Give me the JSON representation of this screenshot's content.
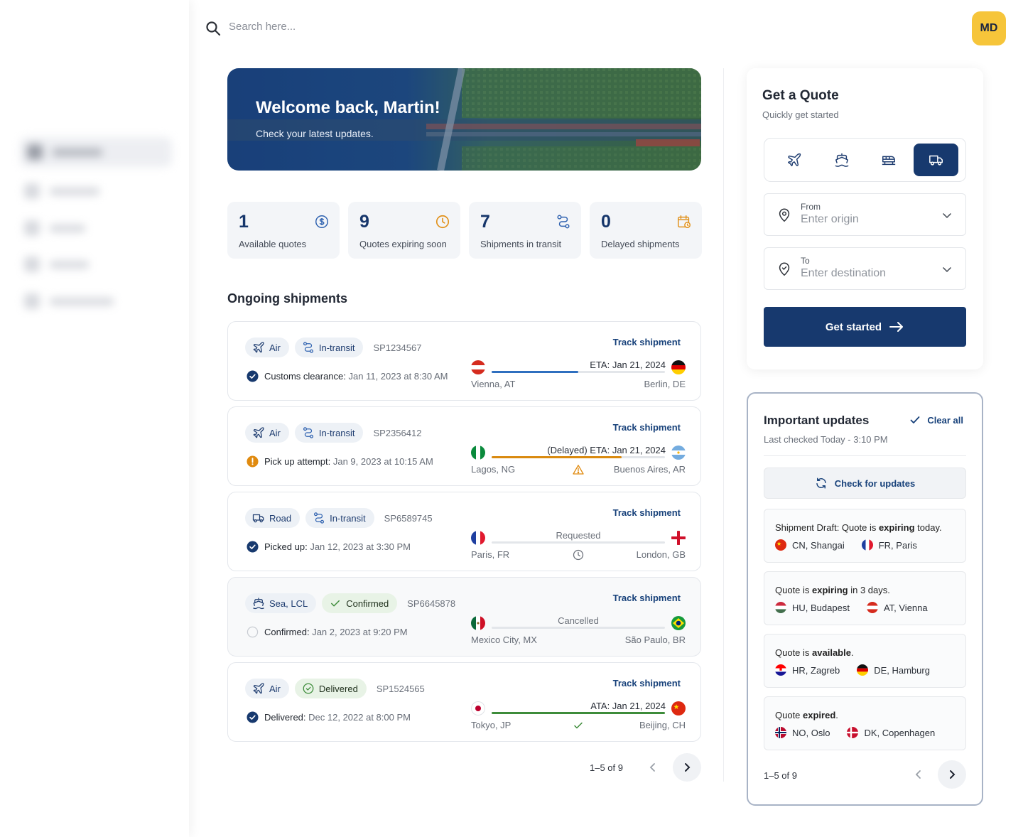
{
  "search": {
    "placeholder": "Search here..."
  },
  "user": {
    "initials": "MD"
  },
  "hero": {
    "title": "Welcome back, Martin!",
    "subtitle": "Check your latest updates."
  },
  "stats": [
    {
      "value": "1",
      "label": "Available quotes",
      "icon": "dollar-circle-icon",
      "color": "#2f62b0"
    },
    {
      "value": "9",
      "label": "Quotes expiring soon",
      "icon": "clock-icon",
      "color": "#e1911b"
    },
    {
      "value": "7",
      "label": "Shipments in transit",
      "icon": "route-icon",
      "color": "#2f62b0"
    },
    {
      "value": "0",
      "label": "Delayed shipments",
      "icon": "calendar-clock-icon",
      "color": "#e1911b"
    }
  ],
  "shipments_title": "Ongoing shipments",
  "shipments": [
    {
      "mode": "Air",
      "mode_icon": "plane-icon",
      "state": "In-transit",
      "id": "SP1234567",
      "track": "Track shipment",
      "status_label": "Customs clearance:",
      "status_date": "Jan 11, 2023 at 8:30 AM",
      "status_icon": "check-circle-icon",
      "eta": "ETA: Jan 21, 2024",
      "progress": 0.5,
      "bar_color": "#2f6fbf",
      "from_city": "Vienna, AT",
      "to_city": "Berlin, DE",
      "from_flag": "AT",
      "to_flag": "DE"
    },
    {
      "mode": "Air",
      "mode_icon": "plane-icon",
      "state": "In-transit",
      "id": "SP2356412",
      "track": "Track shipment",
      "status_label": "Pick up attempt:",
      "status_date": "Jan 9, 2023 at 10:15 AM",
      "status_icon": "warning-circle-icon",
      "eta": "(Delayed)  ETA: Jan 21, 2024",
      "progress": 0.75,
      "bar_color": "#d98a10",
      "from_city": "Lagos, NG",
      "to_city": "Buenos Aires, AR",
      "from_flag": "NG",
      "to_flag": "AR",
      "mid_icon": "warning-triangle-icon"
    },
    {
      "mode": "Road",
      "mode_icon": "truck-icon",
      "state": "In-transit",
      "id": "SP6589745",
      "track": "Track shipment",
      "status_label": "Picked up:",
      "status_date": "Jan 12, 2023 at 3:30 PM",
      "status_icon": "check-circle-icon",
      "center_label": "Requested",
      "progress": 0,
      "bar_color": "#2f6fbf",
      "from_city": "Paris, FR",
      "to_city": "London, GB",
      "from_flag": "FR",
      "to_flag": "GB",
      "mid_icon": "clock-icon"
    },
    {
      "mode": "Sea, LCL",
      "mode_icon": "ship-icon",
      "state": "Confirmed",
      "id": "SP6645878",
      "track": "Track shipment",
      "status_label": "Confirmed:",
      "status_date": "Jan 2, 2023 at 9:20 PM",
      "status_icon": "empty-circle-icon",
      "center_label": "Cancelled",
      "progress": 0,
      "bar_color": "#2f6fbf",
      "from_city": "Mexico City, MX",
      "to_city": "São Paulo, BR",
      "from_flag": "MX",
      "to_flag": "BR"
    },
    {
      "mode": "Air",
      "mode_icon": "plane-icon",
      "state": "Delivered",
      "id": "SP1524565",
      "track": "Track shipment",
      "status_label": "Delivered:",
      "status_date": "Dec 12, 2022 at 8:00 PM",
      "status_icon": "check-circle-icon",
      "eta": "ATA: Jan 21, 2024",
      "progress": 1,
      "bar_color": "#3d8c3a",
      "from_city": "Tokyo, JP",
      "to_city": "Beijing, CH",
      "from_flag": "JP",
      "to_flag": "CN",
      "mid_icon": "check-icon"
    }
  ],
  "shipments_pager": {
    "label": "1–5 of 9"
  },
  "quote": {
    "title": "Get a Quote",
    "subtitle": "Quickly get started",
    "modes": [
      "plane-icon",
      "ship-icon",
      "train-icon",
      "truck-icon"
    ],
    "selected_mode": "truck-icon",
    "from_label": "From",
    "from_placeholder": "Enter origin",
    "to_label": "To",
    "to_placeholder": "Enter destination",
    "cta": "Get started",
    "accent": "#17396e"
  },
  "updates": {
    "title": "Important updates",
    "subtitle": "Last checked Today - 3:10 PM",
    "clear_label": "Clear all",
    "check_label": "Check for updates",
    "items": [
      {
        "pre": "Shipment Draft: Quote is ",
        "bold": "expiring",
        "post": " today.",
        "from_flag": "CN",
        "from": "CN, Shangai",
        "to_flag": "FR",
        "to": "FR, Paris"
      },
      {
        "pre": "Quote is ",
        "bold": "expiring",
        "post": " in 3 days.",
        "from_flag": "HU",
        "from": "HU, Budapest",
        "to_flag": "AT",
        "to": "AT, Vienna"
      },
      {
        "pre": "Quote is ",
        "bold": "available",
        "post": ".",
        "from_flag": "HR",
        "from": "HR, Zagreb",
        "to_flag": "DE",
        "to": "DE, Hamburg"
      },
      {
        "pre": "Quote ",
        "bold": "expired",
        "post": ".",
        "from_flag": "NO",
        "from": "NO, Oslo",
        "to_flag": "DK",
        "to": "DK, Copenhagen"
      }
    ],
    "pager": "1–5 of 9"
  }
}
